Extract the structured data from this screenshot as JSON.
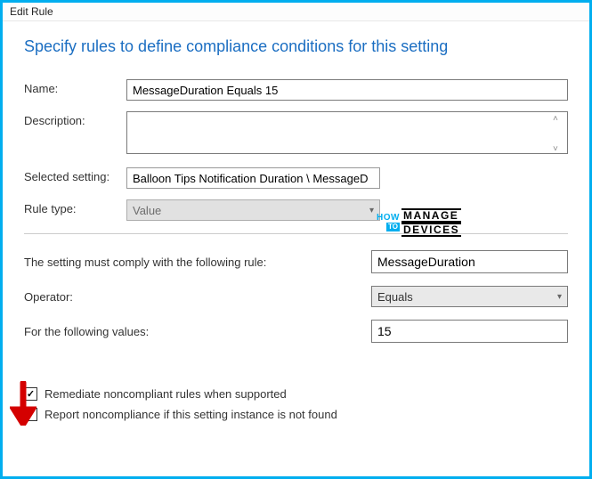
{
  "window": {
    "title": "Edit Rule"
  },
  "heading": "Specify rules to define compliance conditions for this setting",
  "form": {
    "name_label": "Name:",
    "name_value": "MessageDuration Equals 15",
    "description_label": "Description:",
    "description_value": "",
    "selected_setting_label": "Selected setting:",
    "selected_setting_value": "Balloon Tips Notification Duration \\ MessageD",
    "rule_type_label": "Rule type:",
    "rule_type_value": "Value"
  },
  "rule": {
    "comply_label": "The setting must comply with the following rule:",
    "comply_value": "MessageDuration",
    "operator_label": "Operator:",
    "operator_value": "Equals",
    "values_label": "For the following values:",
    "values_value": "15"
  },
  "checkboxes": {
    "remediate_label": "Remediate noncompliant rules when supported",
    "remediate_checked": true,
    "report_label": "Report noncompliance if this setting instance is not found",
    "report_checked": false
  },
  "logo": {
    "how": "HOW",
    "to": "TO",
    "manage": "MANAGE",
    "devices": "DEVICES"
  }
}
